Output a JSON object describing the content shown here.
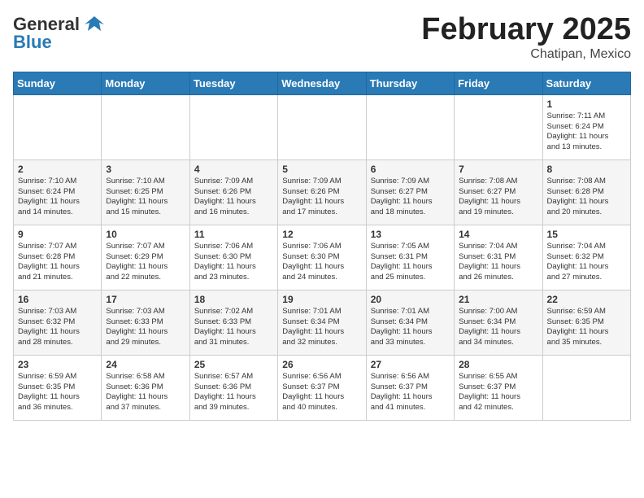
{
  "header": {
    "logo_general": "General",
    "logo_blue": "Blue",
    "month_year": "February 2025",
    "subtitle": "Chatipan, Mexico"
  },
  "weekdays": [
    "Sunday",
    "Monday",
    "Tuesday",
    "Wednesday",
    "Thursday",
    "Friday",
    "Saturday"
  ],
  "weeks": [
    [
      {
        "day": "",
        "info": ""
      },
      {
        "day": "",
        "info": ""
      },
      {
        "day": "",
        "info": ""
      },
      {
        "day": "",
        "info": ""
      },
      {
        "day": "",
        "info": ""
      },
      {
        "day": "",
        "info": ""
      },
      {
        "day": "1",
        "info": "Sunrise: 7:11 AM\nSunset: 6:24 PM\nDaylight: 11 hours\nand 13 minutes."
      }
    ],
    [
      {
        "day": "2",
        "info": "Sunrise: 7:10 AM\nSunset: 6:24 PM\nDaylight: 11 hours\nand 14 minutes."
      },
      {
        "day": "3",
        "info": "Sunrise: 7:10 AM\nSunset: 6:25 PM\nDaylight: 11 hours\nand 15 minutes."
      },
      {
        "day": "4",
        "info": "Sunrise: 7:09 AM\nSunset: 6:26 PM\nDaylight: 11 hours\nand 16 minutes."
      },
      {
        "day": "5",
        "info": "Sunrise: 7:09 AM\nSunset: 6:26 PM\nDaylight: 11 hours\nand 17 minutes."
      },
      {
        "day": "6",
        "info": "Sunrise: 7:09 AM\nSunset: 6:27 PM\nDaylight: 11 hours\nand 18 minutes."
      },
      {
        "day": "7",
        "info": "Sunrise: 7:08 AM\nSunset: 6:27 PM\nDaylight: 11 hours\nand 19 minutes."
      },
      {
        "day": "8",
        "info": "Sunrise: 7:08 AM\nSunset: 6:28 PM\nDaylight: 11 hours\nand 20 minutes."
      }
    ],
    [
      {
        "day": "9",
        "info": "Sunrise: 7:07 AM\nSunset: 6:28 PM\nDaylight: 11 hours\nand 21 minutes."
      },
      {
        "day": "10",
        "info": "Sunrise: 7:07 AM\nSunset: 6:29 PM\nDaylight: 11 hours\nand 22 minutes."
      },
      {
        "day": "11",
        "info": "Sunrise: 7:06 AM\nSunset: 6:30 PM\nDaylight: 11 hours\nand 23 minutes."
      },
      {
        "day": "12",
        "info": "Sunrise: 7:06 AM\nSunset: 6:30 PM\nDaylight: 11 hours\nand 24 minutes."
      },
      {
        "day": "13",
        "info": "Sunrise: 7:05 AM\nSunset: 6:31 PM\nDaylight: 11 hours\nand 25 minutes."
      },
      {
        "day": "14",
        "info": "Sunrise: 7:04 AM\nSunset: 6:31 PM\nDaylight: 11 hours\nand 26 minutes."
      },
      {
        "day": "15",
        "info": "Sunrise: 7:04 AM\nSunset: 6:32 PM\nDaylight: 11 hours\nand 27 minutes."
      }
    ],
    [
      {
        "day": "16",
        "info": "Sunrise: 7:03 AM\nSunset: 6:32 PM\nDaylight: 11 hours\nand 28 minutes."
      },
      {
        "day": "17",
        "info": "Sunrise: 7:03 AM\nSunset: 6:33 PM\nDaylight: 11 hours\nand 29 minutes."
      },
      {
        "day": "18",
        "info": "Sunrise: 7:02 AM\nSunset: 6:33 PM\nDaylight: 11 hours\nand 31 minutes."
      },
      {
        "day": "19",
        "info": "Sunrise: 7:01 AM\nSunset: 6:34 PM\nDaylight: 11 hours\nand 32 minutes."
      },
      {
        "day": "20",
        "info": "Sunrise: 7:01 AM\nSunset: 6:34 PM\nDaylight: 11 hours\nand 33 minutes."
      },
      {
        "day": "21",
        "info": "Sunrise: 7:00 AM\nSunset: 6:34 PM\nDaylight: 11 hours\nand 34 minutes."
      },
      {
        "day": "22",
        "info": "Sunrise: 6:59 AM\nSunset: 6:35 PM\nDaylight: 11 hours\nand 35 minutes."
      }
    ],
    [
      {
        "day": "23",
        "info": "Sunrise: 6:59 AM\nSunset: 6:35 PM\nDaylight: 11 hours\nand 36 minutes."
      },
      {
        "day": "24",
        "info": "Sunrise: 6:58 AM\nSunset: 6:36 PM\nDaylight: 11 hours\nand 37 minutes."
      },
      {
        "day": "25",
        "info": "Sunrise: 6:57 AM\nSunset: 6:36 PM\nDaylight: 11 hours\nand 39 minutes."
      },
      {
        "day": "26",
        "info": "Sunrise: 6:56 AM\nSunset: 6:37 PM\nDaylight: 11 hours\nand 40 minutes."
      },
      {
        "day": "27",
        "info": "Sunrise: 6:56 AM\nSunset: 6:37 PM\nDaylight: 11 hours\nand 41 minutes."
      },
      {
        "day": "28",
        "info": "Sunrise: 6:55 AM\nSunset: 6:37 PM\nDaylight: 11 hours\nand 42 minutes."
      },
      {
        "day": "",
        "info": ""
      }
    ]
  ]
}
